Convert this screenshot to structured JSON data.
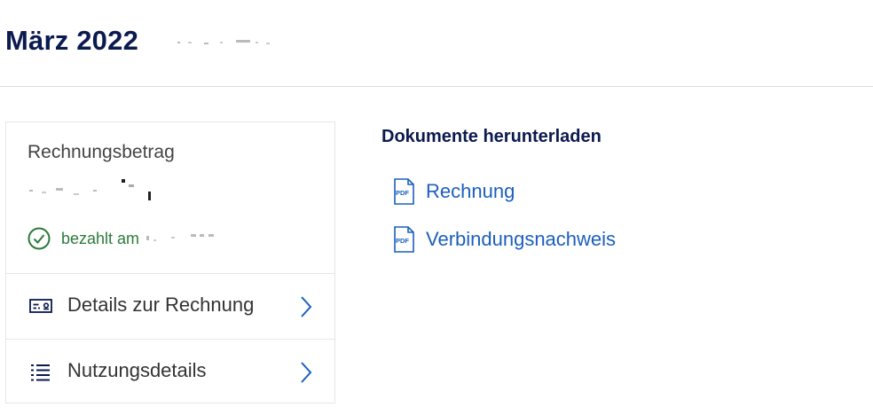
{
  "header": {
    "title": "März 2022"
  },
  "invoice_card": {
    "amount_label": "Rechnungsbetrag",
    "paid_text": "bezahlt am",
    "rows": [
      {
        "label": "Details zur Rechnung",
        "icon": "invoice-details-icon"
      },
      {
        "label": "Nutzungsdetails",
        "icon": "list-icon"
      }
    ]
  },
  "downloads": {
    "title": "Dokumente herunterladen",
    "items": [
      {
        "label": "Rechnung",
        "icon": "pdf-icon"
      },
      {
        "label": "Verbindungsnachweis",
        "icon": "pdf-icon"
      }
    ]
  },
  "colors": {
    "navy": "#0b1a4f",
    "link": "#1c5fbd",
    "success": "#2c7a3a",
    "border": "#e6e6e6"
  }
}
